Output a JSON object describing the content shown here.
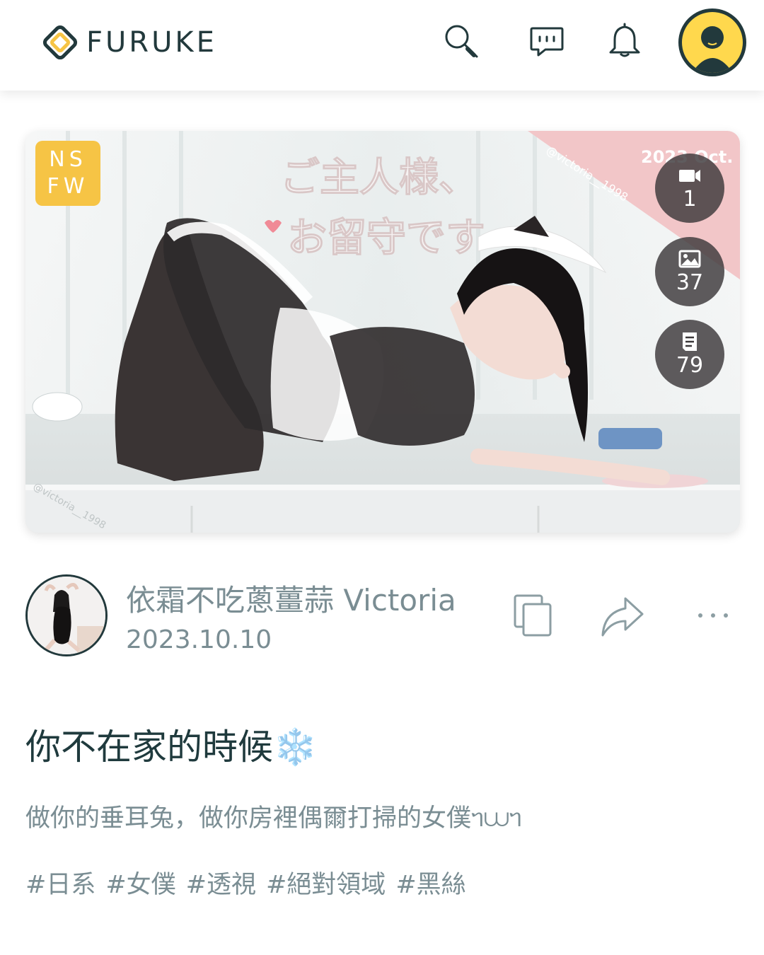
{
  "header": {
    "logo_text": "FURUKE",
    "icons": [
      "search-icon",
      "chat-icon",
      "bell-icon",
      "user-avatar"
    ]
  },
  "hero": {
    "badge": "NSFW",
    "overlay_text_line1": "ご主人様、",
    "overlay_text_line2": "お留守です",
    "corner_text": "2023 Oct.",
    "watermark": "@victoria__1998",
    "stats": [
      {
        "icon": "video-icon",
        "count": "1"
      },
      {
        "icon": "image-icon",
        "count": "37"
      },
      {
        "icon": "document-icon",
        "count": "79"
      }
    ]
  },
  "author": {
    "name": "依霜不吃蔥薑蒜 Victoria",
    "date": "2023.10.10"
  },
  "post": {
    "title": "你不在家的時候❄️",
    "description": "做你的垂耳兔，做你房裡偶爾打掃的女僕ᥐ⩊ᥐ",
    "tags": [
      "#日系",
      "#女僕",
      "#透視",
      "#絕對領域",
      "#黑絲"
    ]
  },
  "colors": {
    "brand_dark": "#22393c",
    "accent_yellow": "#f6c445",
    "muted_text": "#7a8d93",
    "stat_bubble": "#3c383a"
  }
}
